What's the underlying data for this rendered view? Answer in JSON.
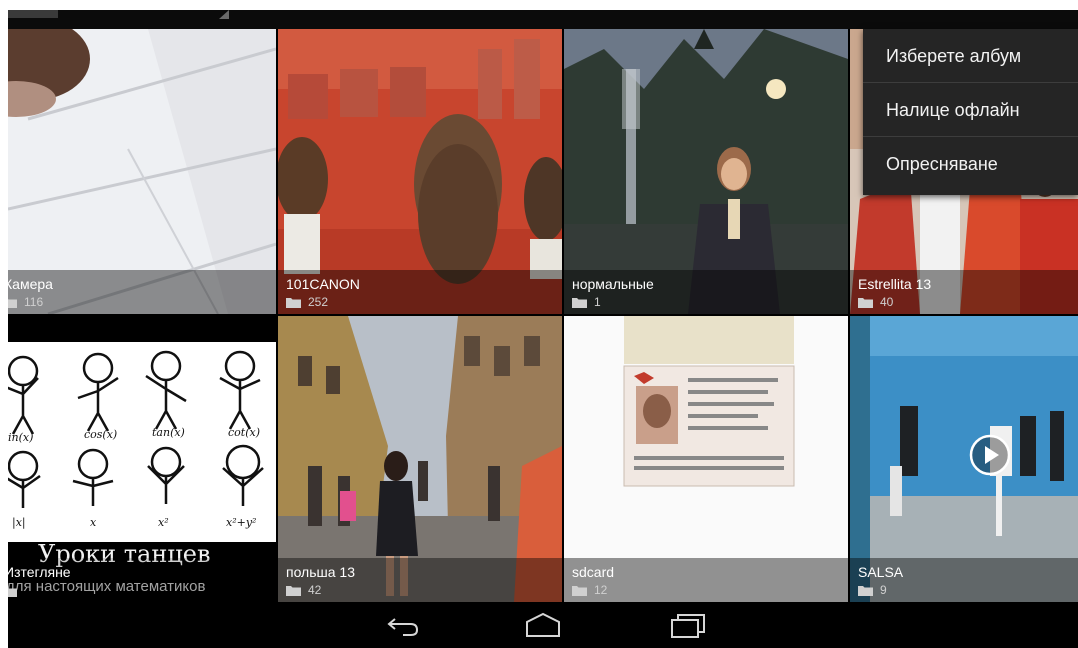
{
  "albums": [
    {
      "name": "Камера",
      "count": "116"
    },
    {
      "name": "101CANON",
      "count": "252"
    },
    {
      "name": "нормальные",
      "count": "1"
    },
    {
      "name": "Estrellita 13",
      "count": "40"
    },
    {
      "name": "Изтегляне",
      "count": ""
    },
    {
      "name": "польша 13",
      "count": "42"
    },
    {
      "name": "sdcard",
      "count": "12"
    },
    {
      "name": "SALSA",
      "count": "9"
    }
  ],
  "overflow_menu": {
    "items": [
      "Изберете албум",
      "Налице офлайн",
      "Опресняване"
    ]
  },
  "thumbnail_text": {
    "title": "Уроки танцев",
    "subtitle": "для настоящих математиков",
    "formulas": [
      "in(x)",
      "cos(x)",
      "tan(x)",
      "cot(x)",
      "|x|",
      "x",
      "x²",
      "x²+y²"
    ]
  },
  "navigation": {
    "back": "back-icon",
    "home": "home-icon",
    "recents": "recents-icon"
  },
  "colors": {
    "label_bar": "#000000",
    "menu_background": "#252525",
    "screen_background": "#000000"
  }
}
